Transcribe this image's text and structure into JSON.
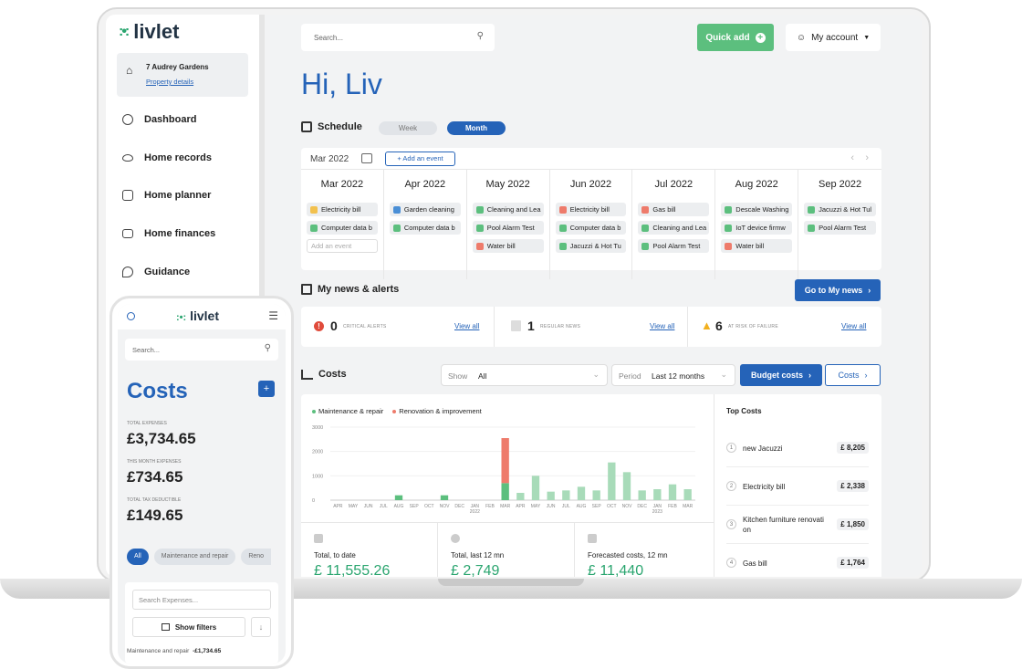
{
  "brand": {
    "name": "livlet",
    "dots": ":•:",
    "accent": "#2aa56f",
    "primary": "#2563b8"
  },
  "sidebar": {
    "property": {
      "name": "7 Audrey Gardens",
      "link": "Property details"
    },
    "items": [
      {
        "label": "Dashboard",
        "icon": "dashboard-icon"
      },
      {
        "label": "Home records",
        "icon": "eye-icon"
      },
      {
        "label": "Home planner",
        "icon": "planner-icon"
      },
      {
        "label": "Home finances",
        "icon": "wallet-icon"
      },
      {
        "label": "Guidance",
        "icon": "guidance-icon"
      }
    ]
  },
  "header": {
    "search_placeholder": "Search...",
    "quick_add": "Quick add",
    "my_account": "My account",
    "greeting": "Hi, Liv"
  },
  "schedule": {
    "title": "Schedule",
    "tabs": [
      "Week",
      "Month"
    ],
    "current": "Mar 2022",
    "add_event": "+ Add an event",
    "add_event_placeholder": "Add an event",
    "months": [
      {
        "name": "Mar 2022",
        "events": [
          {
            "label": "Electricity bill",
            "color": "#f2c14e"
          },
          {
            "label": "Computer data b",
            "color": "#5cbf7e"
          }
        ]
      },
      {
        "name": "Apr 2022",
        "events": [
          {
            "label": "Garden cleaning",
            "color": "#4a8fd6"
          },
          {
            "label": "Computer data b",
            "color": "#5cbf7e"
          }
        ]
      },
      {
        "name": "May 2022",
        "events": [
          {
            "label": "Cleaning and Lea",
            "color": "#5cbf7e"
          },
          {
            "label": "Pool Alarm Test",
            "color": "#5cbf7e"
          },
          {
            "label": "Water bill",
            "color": "#ee7b6b"
          }
        ]
      },
      {
        "name": "Jun 2022",
        "events": [
          {
            "label": "Electricity bill",
            "color": "#ee7b6b"
          },
          {
            "label": "Computer data b",
            "color": "#5cbf7e"
          },
          {
            "label": "Jacuzzi & Hot Tu",
            "color": "#5cbf7e"
          }
        ]
      },
      {
        "name": "Jul 2022",
        "events": [
          {
            "label": "Gas bill",
            "color": "#ee7b6b"
          },
          {
            "label": "Cleaning and Lea",
            "color": "#5cbf7e"
          },
          {
            "label": "Pool Alarm Test",
            "color": "#5cbf7e"
          }
        ]
      },
      {
        "name": "Aug 2022",
        "events": [
          {
            "label": "Descale Washing",
            "color": "#5cbf7e"
          },
          {
            "label": "IoT device firmw",
            "color": "#5cbf7e"
          },
          {
            "label": "Water bill",
            "color": "#ee7b6b"
          }
        ]
      },
      {
        "name": "Sep 2022",
        "events": [
          {
            "label": "Jacuzzi & Hot Tul",
            "color": "#5cbf7e"
          },
          {
            "label": "Pool Alarm Test",
            "color": "#5cbf7e"
          }
        ]
      }
    ]
  },
  "news": {
    "title": "My news & alerts",
    "go_button": "Go to My news",
    "view_all": "View all",
    "stats": [
      {
        "count": "0",
        "label": "CRITICAL ALERTS",
        "color": "#e04b3b"
      },
      {
        "count": "1",
        "label": "REGULAR NEWS",
        "color": "#999999"
      },
      {
        "count": "6",
        "label": "AT RISK OF FAILURE",
        "color": "#f2b01e"
      }
    ]
  },
  "costs": {
    "title": "Costs",
    "show_label": "Show",
    "show_value": "All",
    "period_label": "Period",
    "period_value": "Last 12 months",
    "budget_button": "Budget costs",
    "costs_button": "Costs",
    "legend": [
      {
        "name": "Maintenance & repair",
        "color": "#5cbf7e"
      },
      {
        "name": "Renovation & improvement",
        "color": "#ee7b6b"
      }
    ],
    "summary": [
      {
        "label": "Total, to date",
        "value": "£ 11,555.26"
      },
      {
        "label": "Total, last 12 mn",
        "value": "£ 2,749"
      },
      {
        "label": "Forecasted costs, 12 mn",
        "value": "£ 11,440"
      }
    ],
    "top_title": "Top Costs",
    "top": [
      {
        "rank": "1",
        "name": "new Jacuzzi",
        "value": "£ 8,205"
      },
      {
        "rank": "2",
        "name": "Electricity bill",
        "value": "£ 2,338"
      },
      {
        "rank": "3",
        "name": "Kitchen furniture renovati on",
        "value": "£ 1,850"
      },
      {
        "rank": "4",
        "name": "Gas bill",
        "value": "£ 1,764"
      }
    ]
  },
  "chart_data": {
    "type": "bar",
    "categories": [
      "APR",
      "MAY",
      "JUN",
      "JUL",
      "AUG",
      "SEP",
      "OCT",
      "NOV",
      "DEC",
      "JAN",
      "FEB",
      "MAR",
      "APR",
      "MAY",
      "JUN",
      "JUL",
      "AUG",
      "SEP",
      "OCT",
      "NOV",
      "DEC",
      "JAN",
      "FEB",
      "MAR"
    ],
    "year_labels": [
      {
        "index": 9,
        "label": "2022"
      },
      {
        "index": 21,
        "label": "2023"
      }
    ],
    "series": [
      {
        "name": "Maintenance & repair",
        "values": [
          0,
          0,
          0,
          0,
          200,
          0,
          0,
          200,
          0,
          0,
          0,
          700,
          300,
          1000,
          350,
          400,
          550,
          400,
          1550,
          1150,
          400,
          450,
          650,
          450
        ]
      },
      {
        "name": "Renovation & improvement",
        "values": [
          0,
          0,
          0,
          0,
          0,
          0,
          0,
          0,
          0,
          0,
          0,
          1850,
          0,
          0,
          0,
          0,
          0,
          0,
          0,
          0,
          0,
          0,
          0,
          0
        ]
      }
    ],
    "yticks": [
      0,
      1000,
      2000,
      3000
    ],
    "ylim": [
      0,
      3000
    ]
  },
  "phone": {
    "search_placeholder": "Search...",
    "title": "Costs",
    "stats": [
      {
        "label": "TOTAL EXPENSES",
        "value": "£3,734.65"
      },
      {
        "label": "THIS MONTH EXPENSES",
        "value": "£734.65"
      },
      {
        "label": "TOTAL TAX DEDUCTIBLE",
        "value": "£149.65"
      }
    ],
    "chips": [
      "All",
      "Maintenance and repair",
      "Reno"
    ],
    "search_expenses": "Search Expenses...",
    "show_filters": "Show filters",
    "row_label": "Maintenance and repair",
    "row_value": "-£1,734.65"
  }
}
